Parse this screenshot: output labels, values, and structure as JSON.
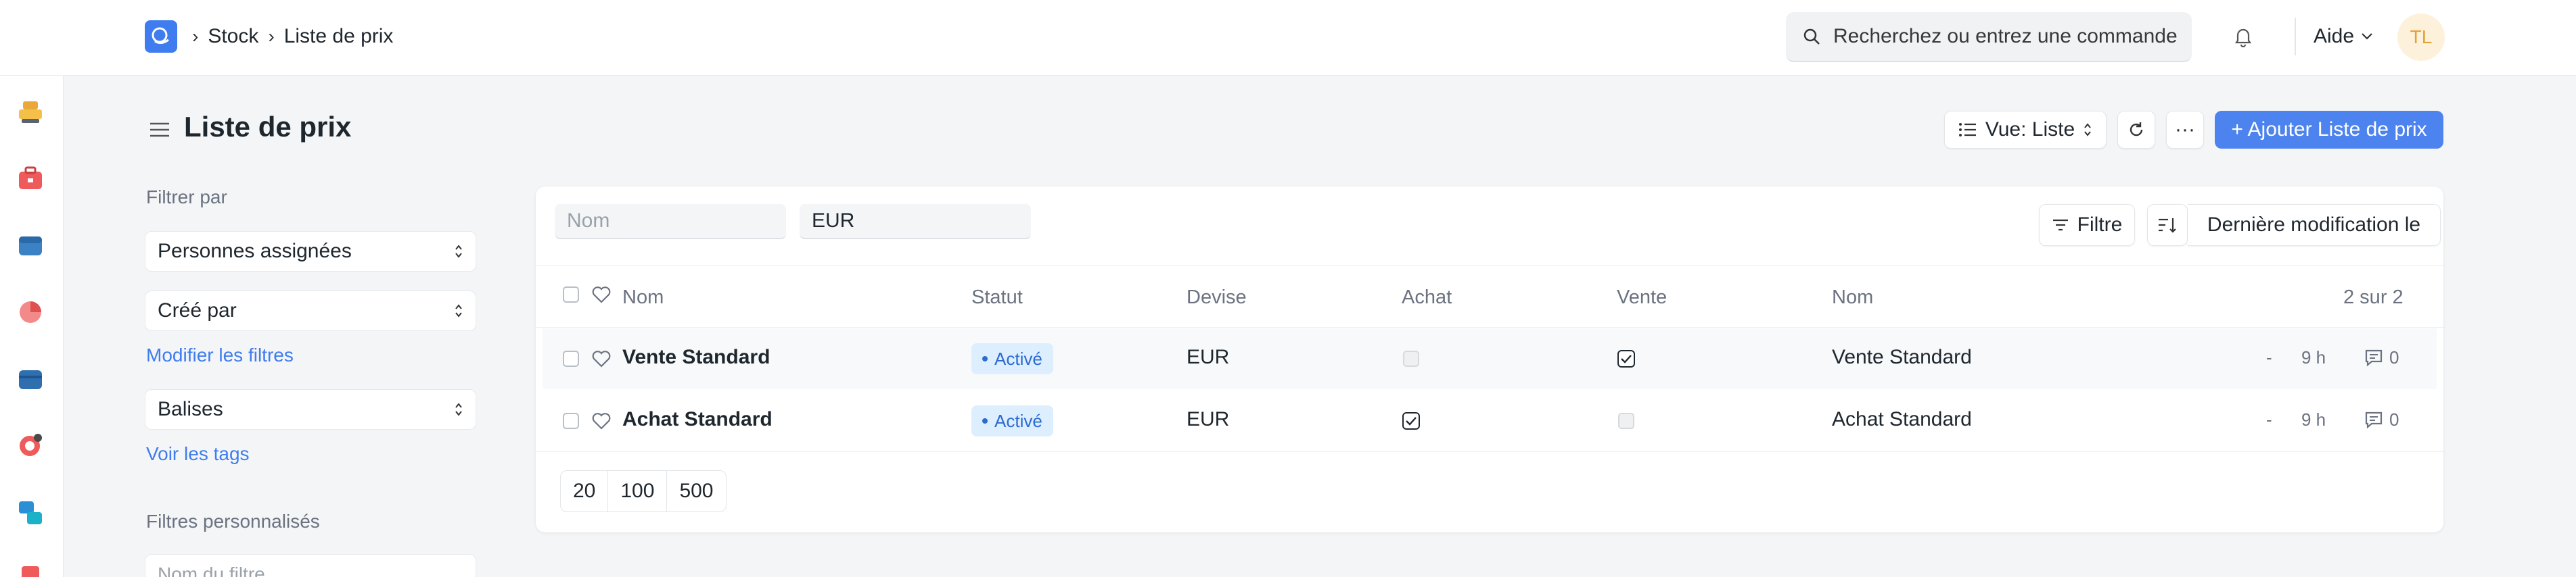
{
  "breadcrumb": {
    "items": [
      "Stock",
      "Liste de prix"
    ]
  },
  "search": {
    "placeholder": "Recherchez ou entrez une commande"
  },
  "help": {
    "label": "Aide"
  },
  "user": {
    "initials": "TL"
  },
  "page": {
    "title": "Liste de prix"
  },
  "toolbar": {
    "view_label": "Vue: Liste",
    "more_label": "···",
    "add_label": "+ Ajouter Liste de prix"
  },
  "sidebar": {
    "filter_by": "Filtrer par",
    "assigned": "Personnes assignées",
    "created_by": "Créé par",
    "edit_filters": "Modifier les filtres",
    "tags": "Balises",
    "show_tags": "Voir les tags",
    "custom_filters": "Filtres personnalisés",
    "filter_name_placeholder": "Nom du filtre"
  },
  "list_filters": {
    "name_placeholder": "Nom",
    "currency_value": "EUR",
    "filter_label": "Filtre",
    "sort_label": "Dernière modification le"
  },
  "table": {
    "headers": [
      "Nom",
      "Statut",
      "Devise",
      "Achat",
      "Vente",
      "Nom"
    ],
    "count": "2 sur 2",
    "rows": [
      {
        "name": "Vente Standard",
        "status": "Activé",
        "currency": "EUR",
        "buying": false,
        "selling": true,
        "name2": "Vente Standard",
        "dash": "-",
        "time": "9 h",
        "comments": "0"
      },
      {
        "name": "Achat Standard",
        "status": "Activé",
        "currency": "EUR",
        "buying": true,
        "selling": false,
        "name2": "Achat Standard",
        "dash": "-",
        "time": "9 h",
        "comments": "0"
      }
    ]
  },
  "pagination": {
    "sizes": [
      "20",
      "100",
      "500"
    ]
  },
  "colors": {
    "accent": "#4c83ee",
    "badge_bg": "#ddeeff",
    "badge_text": "#2c6bd0"
  }
}
